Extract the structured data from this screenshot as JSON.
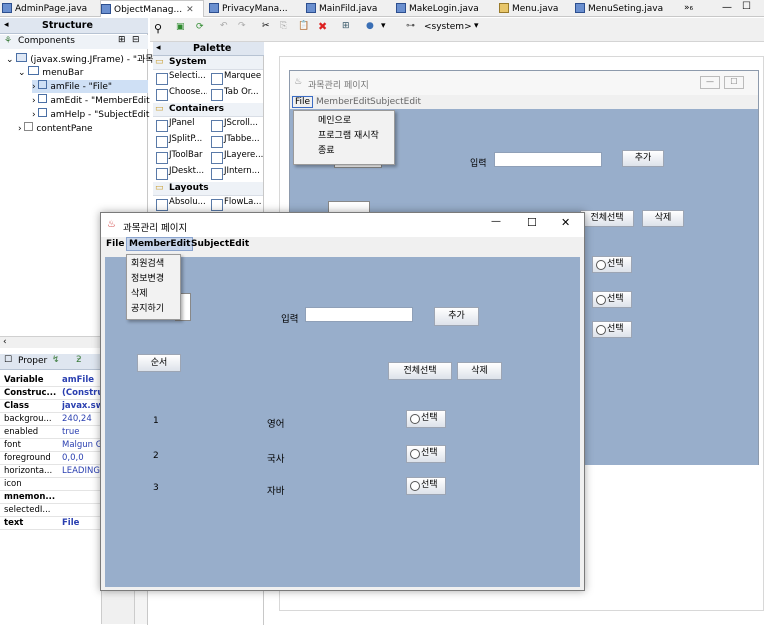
{
  "editor_tabs": [
    {
      "label": "AdminPage.java"
    },
    {
      "label": "ObjectManag..."
    },
    {
      "label": "PrivacyMana..."
    },
    {
      "label": "MainFild.java"
    },
    {
      "label": "MakeLogin.java"
    },
    {
      "label": "Menu.java"
    },
    {
      "label": "MenuSeting.java"
    },
    {
      "label": "»₆"
    }
  ],
  "structure": {
    "title": "Structure",
    "components_label": "Components",
    "tree": [
      "(javax.swing.JFrame) - \"과목",
      "menuBar",
      "amFile - \"File\"",
      "amEdit - \"MemberEdit",
      "amHelp - \"SubjectEdit",
      "contentPane"
    ]
  },
  "properties": {
    "title": "Proper",
    "rows": [
      {
        "key": "Variable",
        "value": "amFile"
      },
      {
        "key": "Construc...",
        "value": "(Construc"
      },
      {
        "key": "Class",
        "value": "javax.swin"
      },
      {
        "key": "backgrou...",
        "value": "240,24"
      },
      {
        "key": "enabled",
        "value": "true"
      },
      {
        "key": "font",
        "value": "Malgun G"
      },
      {
        "key": "foreground",
        "value": "0,0,0"
      },
      {
        "key": "horizonta...",
        "value": "LEADING"
      },
      {
        "key": "icon",
        "value": ""
      },
      {
        "key": "mnemon...",
        "value": ""
      },
      {
        "key": "selectedI...",
        "value": ""
      },
      {
        "key": "text",
        "value": "File"
      }
    ]
  },
  "palette": {
    "title": "Palette",
    "categories": {
      "system": "System",
      "containers": "Containers",
      "layouts": "Layouts"
    },
    "items": {
      "selection": "Selecti...",
      "marquee": "Marquee",
      "choose": "Choose...",
      "taborder": "Tab Or...",
      "jpanel": "JPanel",
      "jscroll": "JScroll...",
      "jsplit": "JSplitP...",
      "jtabbed": "JTabbe...",
      "jtoolbar": "JToolBar",
      "jlayered": "JLayere...",
      "jdesktop": "JDeskt...",
      "jinternal": "JIntern...",
      "absolute": "Absolu...",
      "flow": "FlowLa..."
    }
  },
  "toolbar": {
    "system_label": "<system>"
  },
  "design_frame": {
    "title": "과목관리 페이지",
    "menu": [
      "File",
      "MemberEdit",
      "SubjectEdit"
    ],
    "file_menu_items": [
      "메인으로",
      "프로그램 재시작",
      "종료"
    ],
    "input_label": "입력",
    "add_button": "추가",
    "select_all_button": "전체선택",
    "delete_button": "삭제",
    "radio_label": "선택"
  },
  "run_window": {
    "title": "과목관리 페이지",
    "menu": [
      "File",
      "MemberEdit",
      "SubjectEdit"
    ],
    "member_menu_items": [
      "회원검색",
      "정보변경",
      "삭제",
      "공지하기"
    ],
    "input_label": "입력",
    "add_button": "추가",
    "order_button": "순서",
    "select_all_button": "전체선택",
    "delete_button": "삭제",
    "subjects": [
      {
        "num": "1",
        "name": "영어",
        "radio": "선택"
      },
      {
        "num": "2",
        "name": "국사",
        "radio": "선택"
      },
      {
        "num": "3",
        "name": "자바",
        "radio": "선택"
      }
    ],
    "controls": {
      "minimize": "—",
      "maximize": "☐",
      "close": "✕"
    }
  },
  "colors": {
    "form_bg": "#98aecb",
    "accent": "#2a3fb0"
  }
}
